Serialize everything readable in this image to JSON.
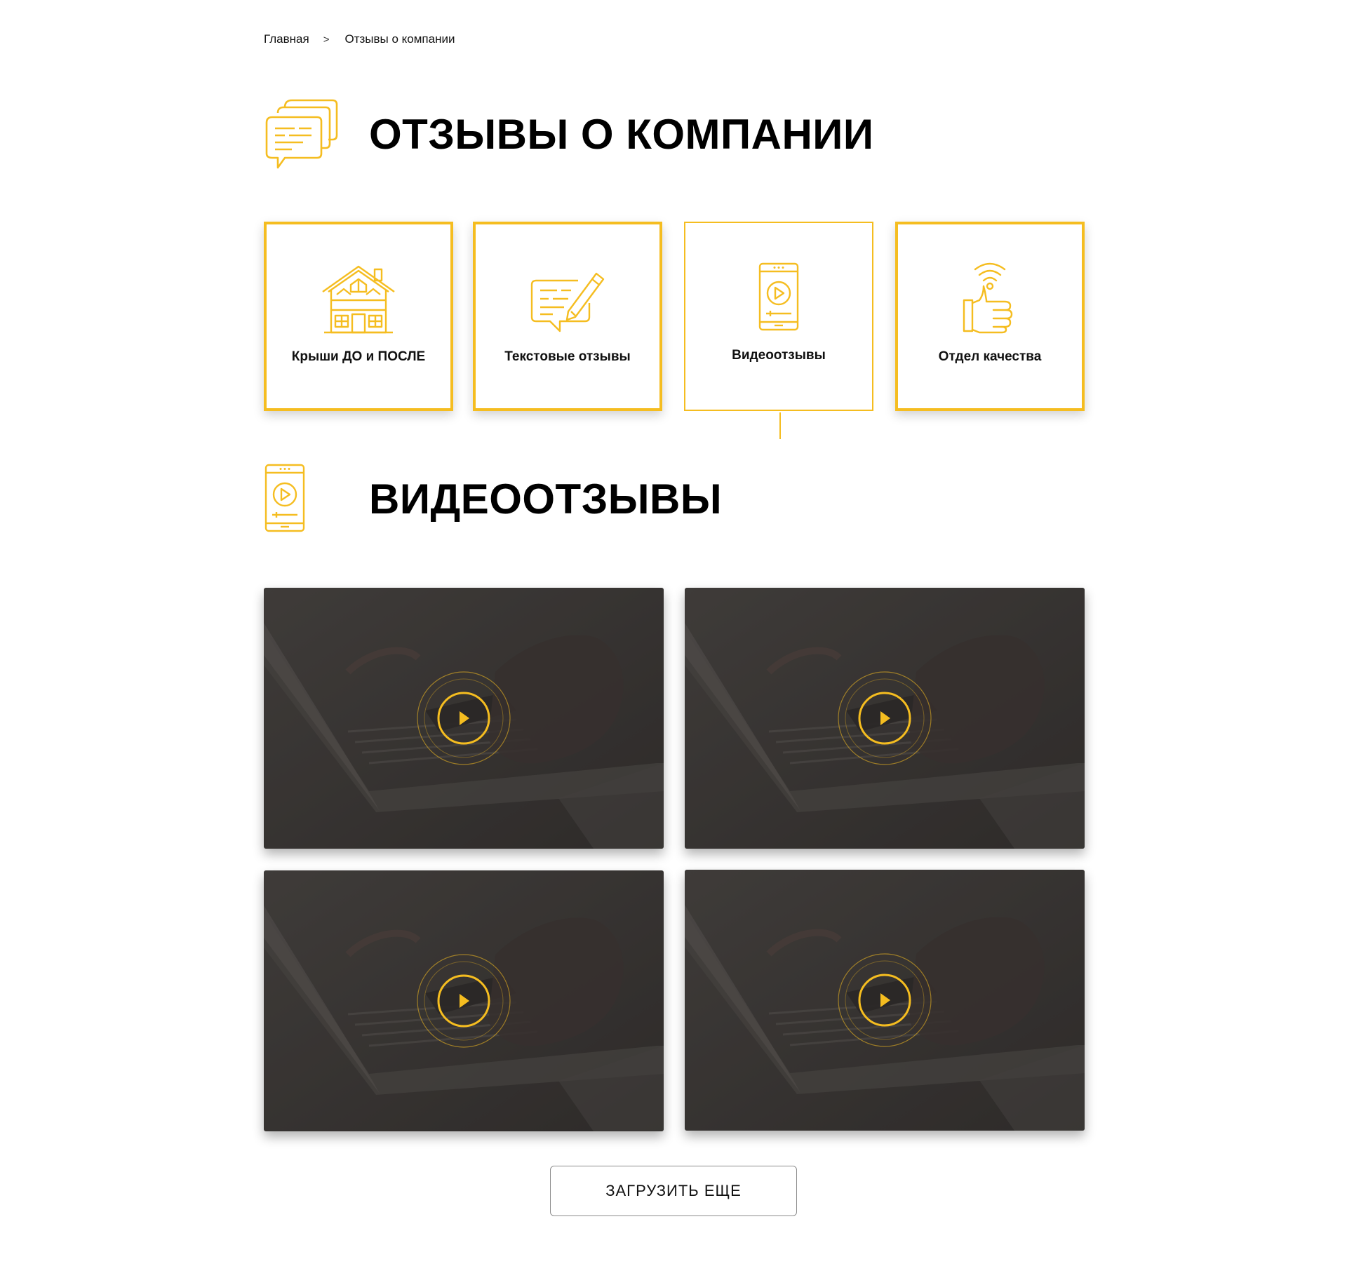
{
  "breadcrumb": {
    "home": "Главная",
    "separator": ">",
    "current": "Отзывы о компании"
  },
  "page": {
    "title": "ОТЗЫВЫ О КОМПАНИИ",
    "icon": "chat-bubbles-icon"
  },
  "categories": [
    {
      "label": "Крыши ДО и ПОСЛЕ",
      "icon": "house-icon",
      "active": false
    },
    {
      "label": "Текстовые отзывы",
      "icon": "message-pencil-icon",
      "active": false
    },
    {
      "label": "Видеоотзывы",
      "icon": "phone-video-icon",
      "active": true
    },
    {
      "label": "Отдел качества",
      "icon": "thumbs-up-signal-icon",
      "active": false
    }
  ],
  "section": {
    "title": "ВИДЕООТЗЫВЫ",
    "icon": "phone-video-icon"
  },
  "videos": [
    {
      "icon": "play-icon"
    },
    {
      "icon": "play-icon"
    },
    {
      "icon": "play-icon"
    },
    {
      "icon": "play-icon"
    }
  ],
  "load_more": {
    "label": "ЗАГРУЗИТЬ ЕЩЕ"
  },
  "colors": {
    "accent": "#f5bd20",
    "text": "#111111",
    "video_overlay": "#3a3735"
  }
}
